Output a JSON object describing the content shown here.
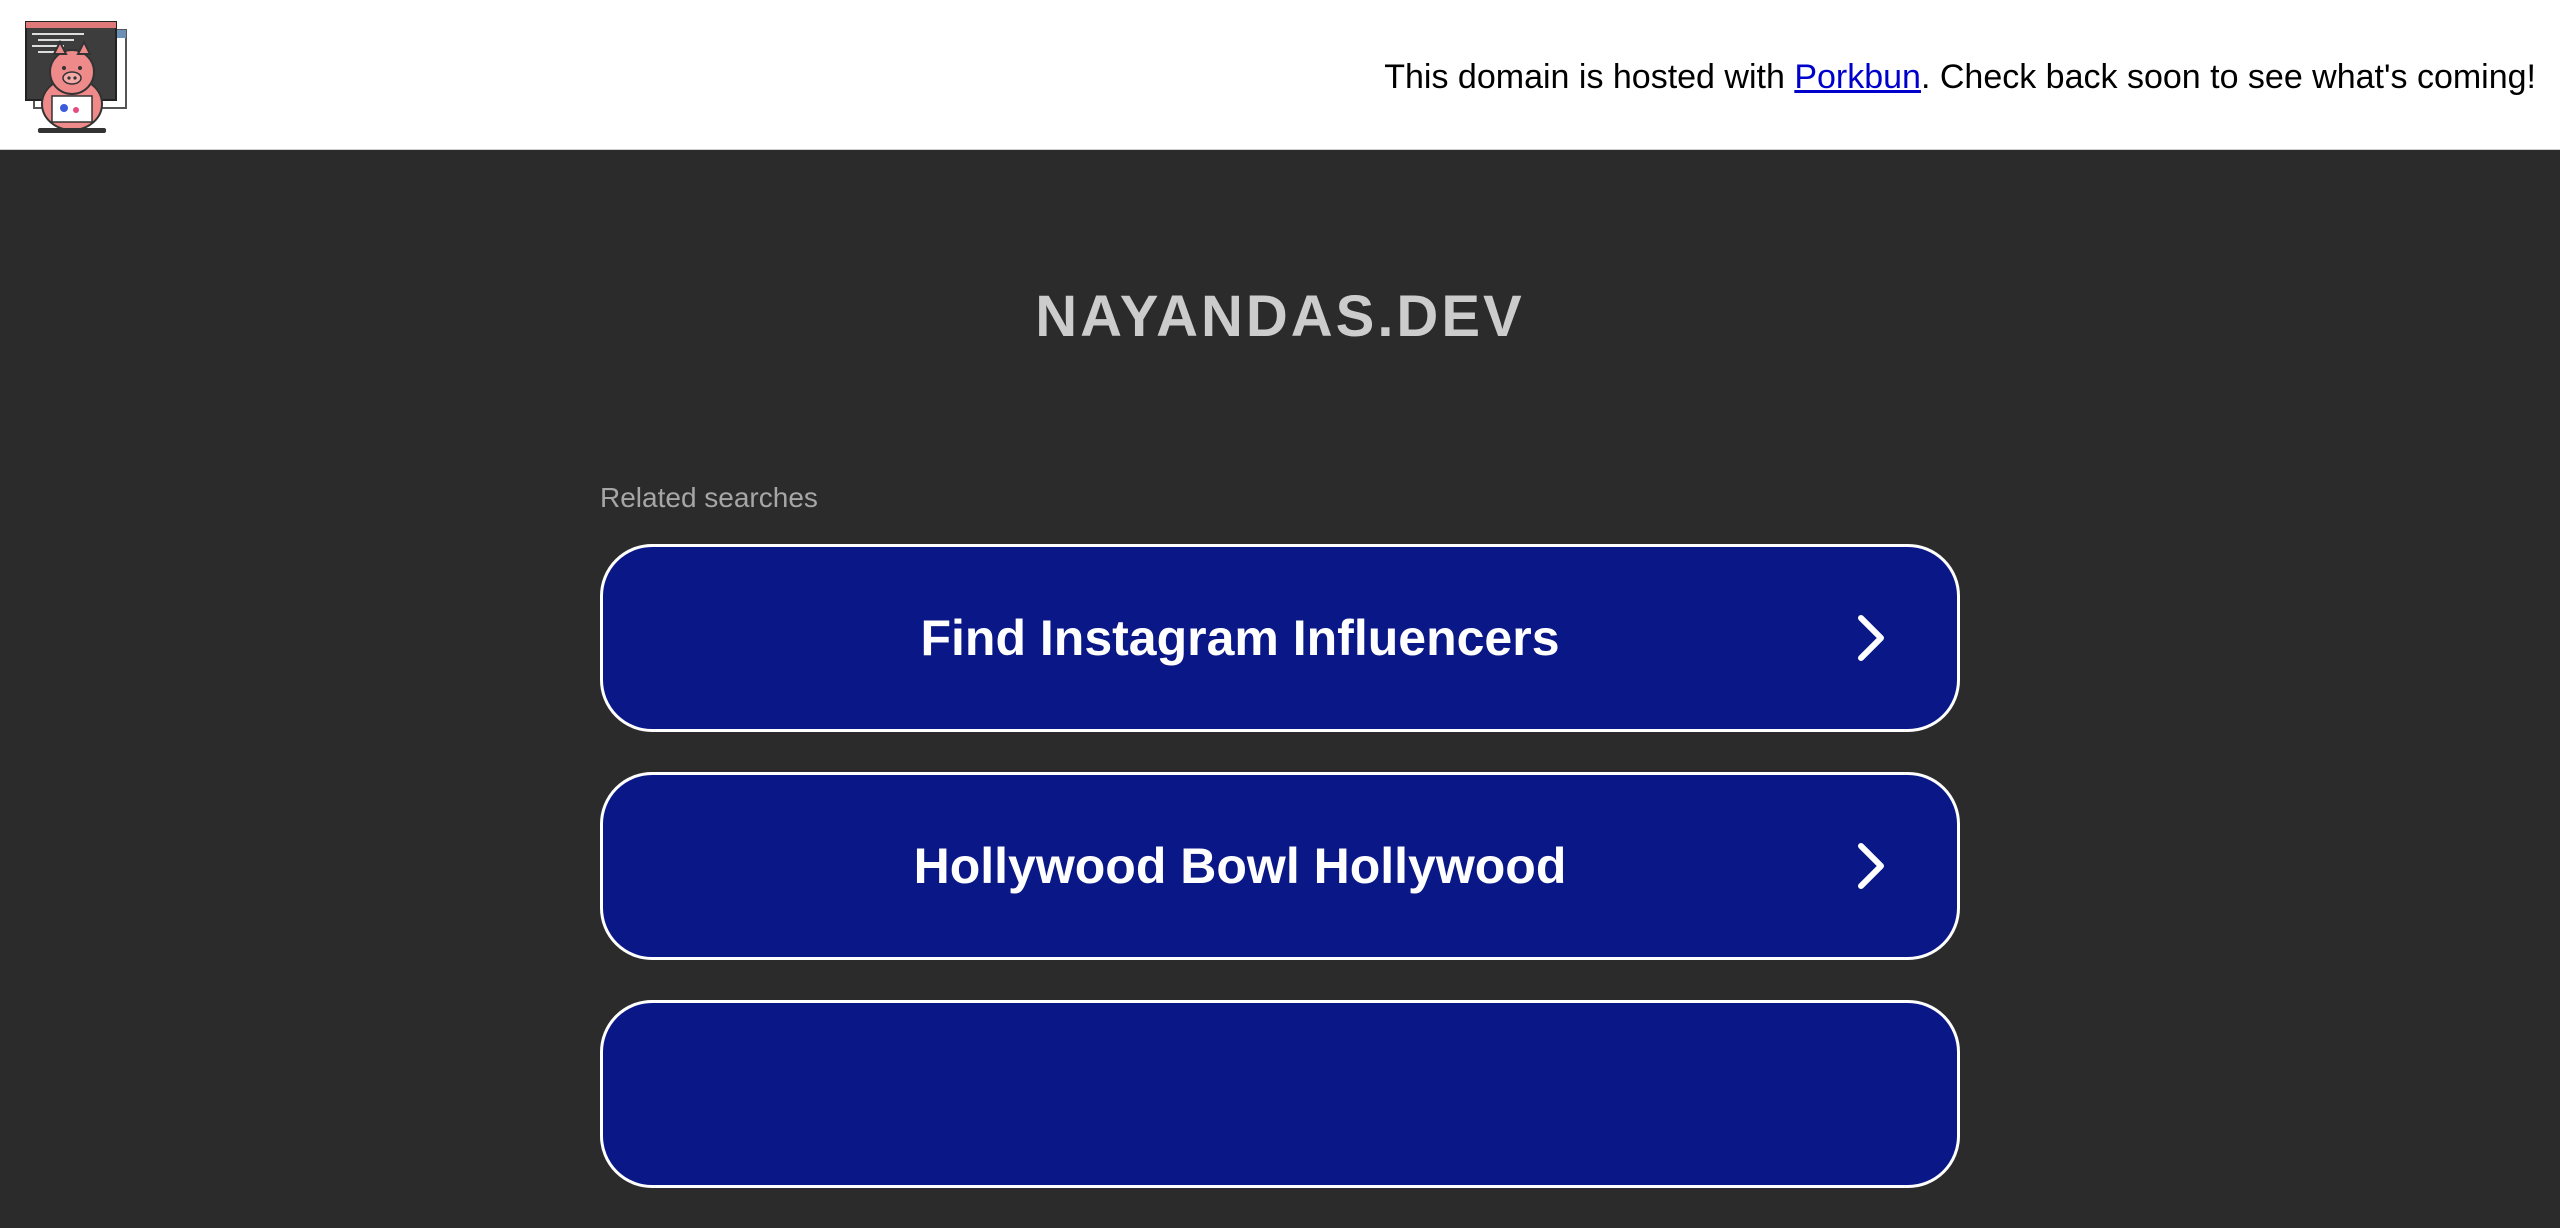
{
  "header": {
    "logo_icon": "porkbun-pig-logo-icon",
    "notice_before": "This domain is hosted with ",
    "notice_link": "Porkbun",
    "notice_after": ". Check back soon to see what's coming!"
  },
  "domain": {
    "title": "NAYANDAS.DEV"
  },
  "related_searches": {
    "label": "Related searches",
    "items": [
      {
        "label": "Find Instagram Influencers",
        "icon": "chevron-right-icon"
      },
      {
        "label": "Hollywood Bowl Hollywood",
        "icon": "chevron-right-icon"
      },
      {
        "label": "",
        "icon": ""
      }
    ]
  },
  "colors": {
    "page_background": "#2b2b2b",
    "topbar_background": "#ffffff",
    "button_background": "#0a1787",
    "button_border": "#ffffff",
    "title_text": "#cccccc",
    "label_text": "#a6a6a6",
    "link": "#0000cc"
  }
}
